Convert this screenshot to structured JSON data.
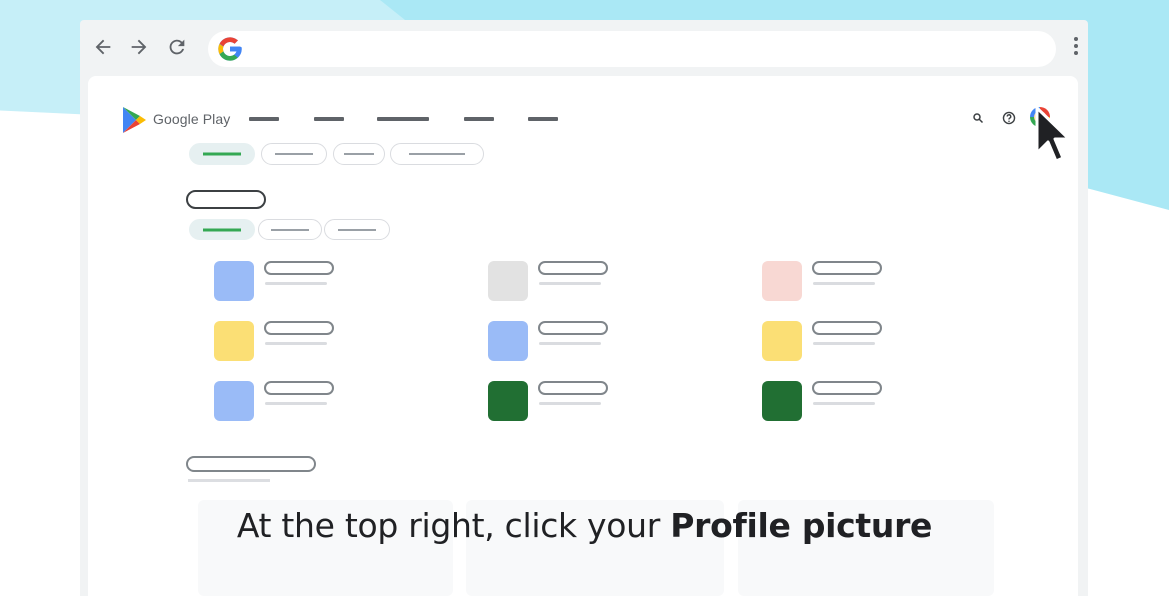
{
  "browser": {
    "back_icon": "arrow-left-icon",
    "forward_icon": "arrow-right-icon",
    "reload_icon": "reload-icon",
    "omnibox_icon": "google-g-icon",
    "menu_icon": "more-vert-icon"
  },
  "play": {
    "brand": "Google Play",
    "header_icons": [
      "search-icon",
      "help-icon",
      "avatar"
    ]
  },
  "apps": [
    {
      "color": "#9abbf7"
    },
    {
      "color": "#e2e2e2"
    },
    {
      "color": "#f8d8d3"
    },
    {
      "color": "#fbdf75"
    },
    {
      "color": "#9abbf7"
    },
    {
      "color": "#fbdf75"
    },
    {
      "color": "#9abbf7"
    },
    {
      "color": "#216f33"
    },
    {
      "color": "#216f33"
    }
  ],
  "caption": {
    "prefix": "At the top right, click your ",
    "bold": "Profile picture"
  }
}
